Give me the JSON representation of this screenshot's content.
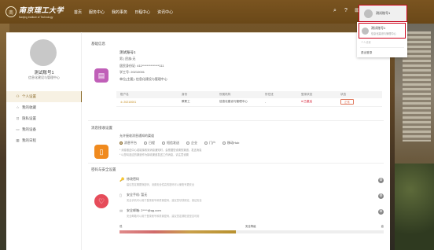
{
  "brand": {
    "seal": "南",
    "name_cn": "南京理工大学",
    "name_en": "Nanjing Institute of Technology"
  },
  "nav": {
    "items": [
      "首页",
      "服务中心",
      "我的事务",
      "日程中心",
      "资讯中心"
    ]
  },
  "topbar": {
    "icons": [
      "search-icon",
      "help-icon",
      "grid-icon",
      "bell-icon"
    ],
    "icon_glyphs": [
      "⌕",
      "?",
      "⊞",
      "🔔"
    ],
    "user_name": "测试账号1"
  },
  "dropdown": {
    "name": "测试账号1",
    "dept": "信息化建设与管理中心",
    "mid": "个人设置",
    "logout": "退出登录"
  },
  "profile": {
    "name": "测试账号1",
    "dept": "信息化建设与管理中心"
  },
  "menu": [
    {
      "label": "个人设置",
      "icon": "user-icon",
      "glyph": "⚇",
      "active": true
    },
    {
      "label": "我的收藏",
      "icon": "star-icon",
      "glyph": "☆",
      "active": false
    },
    {
      "label": "隐私设置",
      "icon": "lock-icon",
      "glyph": "⊡",
      "active": false
    },
    {
      "label": "我的设备",
      "icon": "device-icon",
      "glyph": "▭",
      "active": false
    },
    {
      "label": "我的日程",
      "icon": "calendar-icon",
      "glyph": "▦",
      "active": false
    }
  ],
  "basic": {
    "section_title": "基础信息",
    "name": "测试账号1",
    "gender": "男 | 民族:无",
    "id_no": "居民身份证: 411**************111",
    "job_no": "学工号: 20210001",
    "unit": "单位(主要): 信息化建设与管理中心"
  },
  "identity_table": {
    "headers": [
      "账户名",
      "身份",
      "所属机构",
      "所在班",
      "登录状态",
      "状态"
    ],
    "rows": [
      {
        "account": "20210001",
        "identity": "教职工",
        "org": "信息化建设与管理中心",
        "class": "-",
        "login": "● 已激活",
        "status": "正常"
      }
    ]
  },
  "notify": {
    "section_title": "消息接收设置",
    "label": "允许接收消息通知的渠道",
    "options": [
      "消息平台",
      "日程",
      "短信发送",
      "企业",
      "门户",
      "移动Hub"
    ],
    "selected": [
      0
    ],
    "note1": "* 消息推送中心若能接收到消息通知时，会根据您设置的渠道，发送消息",
    "note2": "* 以您勾选过的渠道作为接收渠道发送工作消息，请注意设置"
  },
  "security": {
    "section_title": "密码与安全设置",
    "items": [
      {
        "title": "修改密码",
        "desc": "建议您定期更换密码，设置安全性高的密码可以使账号更安全",
        "icon": "key-icon",
        "glyph": "🔑"
      },
      {
        "title": "安全手机: 暂无",
        "desc": "安全手机可以用于登录帐号和重置密码，建议您尽快绑定，保证安全",
        "icon": "phone-icon",
        "glyph": "▯"
      },
      {
        "title": "安全邮箱: 2****@qq.com",
        "desc": "安全邮箱可以用于登录帐号和重置密码，建议您定期检查是否可用",
        "icon": "mail-icon",
        "glyph": "✉"
      }
    ],
    "strength_low": "低",
    "strength_mid": "安全等级",
    "strength_high": "高",
    "strength_fill_fraction": 0.44
  },
  "colors": {
    "accent": "#8b6a2a",
    "topbar": "#6a4818",
    "highlight_border": "#d0021b",
    "identity_icon_bg": "#c05fb8",
    "notify_icon_bg": "#f08a1e",
    "security_icon_bg": "#e64c5a"
  }
}
